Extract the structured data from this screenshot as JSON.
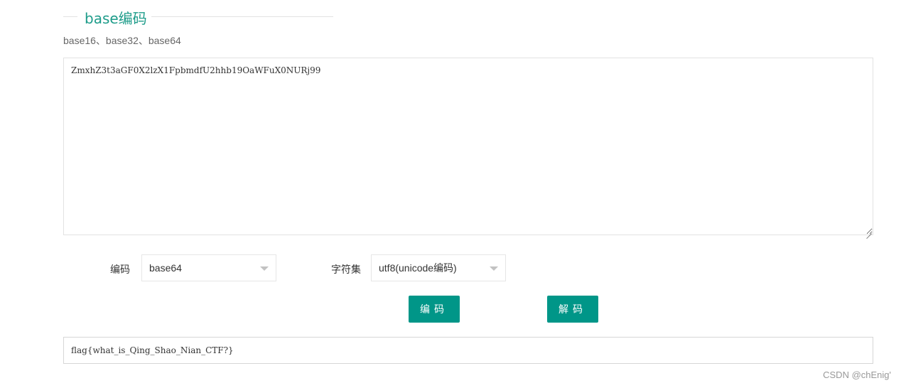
{
  "section": {
    "title": "base编码",
    "subtitle": "base16、base32、base64"
  },
  "input": {
    "value": "ZmxhZ3t3aGF0X2lzX1FpbmdfU2hhb19OaWFuX0NURj99"
  },
  "options": {
    "encoding_label": "编码",
    "encoding_value": "base64",
    "charset_label": "字符集",
    "charset_value": "utf8(unicode编码)"
  },
  "buttons": {
    "encode": "编码",
    "decode": "解码"
  },
  "output": {
    "value": "flag{what_is_Qing_Shao_Nian_CTF?}"
  },
  "watermark": "CSDN @chEnig'",
  "colors": {
    "accent": "#009688",
    "title": "#1e9c8a"
  }
}
